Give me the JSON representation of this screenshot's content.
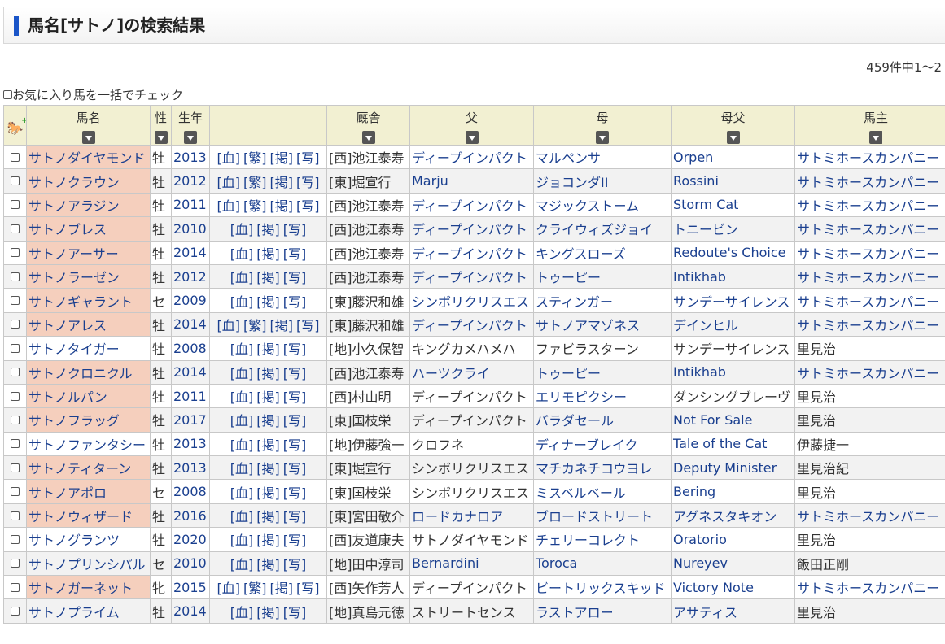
{
  "page": {
    "title": "馬名[サトノ]の検索結果",
    "result_count": "459件中1～2",
    "bulk_check_label": "お気に入り馬を一括でチェック"
  },
  "headers": {
    "name": "馬名",
    "sex": "性",
    "year": "生年",
    "links": "",
    "trainer": "厩舎",
    "sire": "父",
    "dam": "母",
    "damsire": "母父",
    "owner": "馬主"
  },
  "link_labels": {
    "blood": "[血]",
    "hanshoku": "[繁]",
    "keisai": "[掲]",
    "photo": "[写]"
  },
  "rows": [
    {
      "name": "サトノダイヤモンド",
      "sex": "牡",
      "year": "2013",
      "hanshoku": true,
      "trainer": "[西]池江泰寿",
      "sire": "ディープインパクト",
      "sire_link": true,
      "dam": "マルペンサ",
      "dam_link": true,
      "damsire": "Orpen",
      "damsire_link": true,
      "owner": "サトミホースカンパニー",
      "owner_link": true,
      "highlight": true
    },
    {
      "name": "サトノクラウン",
      "sex": "牡",
      "year": "2012",
      "hanshoku": true,
      "trainer": "[東]堀宣行",
      "sire": "Marju",
      "sire_link": true,
      "dam": "ジョコンダII",
      "dam_link": true,
      "damsire": "Rossini",
      "damsire_link": true,
      "owner": "サトミホースカンパニー",
      "owner_link": true,
      "highlight": true
    },
    {
      "name": "サトノアラジン",
      "sex": "牡",
      "year": "2011",
      "hanshoku": true,
      "trainer": "[西]池江泰寿",
      "sire": "ディープインパクト",
      "sire_link": true,
      "dam": "マジックストーム",
      "dam_link": true,
      "damsire": "Storm Cat",
      "damsire_link": true,
      "owner": "サトミホースカンパニー",
      "owner_link": true,
      "highlight": true
    },
    {
      "name": "サトノブレス",
      "sex": "牡",
      "year": "2010",
      "hanshoku": false,
      "trainer": "[西]池江泰寿",
      "sire": "ディープインパクト",
      "sire_link": true,
      "dam": "クライウィズジョイ",
      "dam_link": true,
      "damsire": "トニービン",
      "damsire_link": true,
      "owner": "サトミホースカンパニー",
      "owner_link": true,
      "highlight": true
    },
    {
      "name": "サトノアーサー",
      "sex": "牡",
      "year": "2014",
      "hanshoku": false,
      "trainer": "[西]池江泰寿",
      "sire": "ディープインパクト",
      "sire_link": true,
      "dam": "キングスローズ",
      "dam_link": true,
      "damsire": "Redoute's Choice",
      "damsire_link": true,
      "owner": "サトミホースカンパニー",
      "owner_link": true,
      "highlight": true
    },
    {
      "name": "サトノラーゼン",
      "sex": "牡",
      "year": "2012",
      "hanshoku": false,
      "trainer": "[西]池江泰寿",
      "sire": "ディープインパクト",
      "sire_link": true,
      "dam": "トゥーピー",
      "dam_link": true,
      "damsire": "Intikhab",
      "damsire_link": true,
      "owner": "サトミホースカンパニー",
      "owner_link": true,
      "highlight": true
    },
    {
      "name": "サトノギャラント",
      "sex": "セ",
      "year": "2009",
      "hanshoku": false,
      "trainer": "[東]藤沢和雄",
      "sire": "シンボリクリスエス",
      "sire_link": true,
      "dam": "スティンガー",
      "dam_link": true,
      "damsire": "サンデーサイレンス",
      "damsire_link": true,
      "owner": "サトミホースカンパニー",
      "owner_link": true,
      "highlight": true
    },
    {
      "name": "サトノアレス",
      "sex": "牡",
      "year": "2014",
      "hanshoku": true,
      "trainer": "[東]藤沢和雄",
      "sire": "ディープインパクト",
      "sire_link": true,
      "dam": "サトノアマゾネス",
      "dam_link": true,
      "damsire": "デインヒル",
      "damsire_link": true,
      "owner": "サトミホースカンパニー",
      "owner_link": true,
      "highlight": true
    },
    {
      "name": "サトノタイガー",
      "sex": "牡",
      "year": "2008",
      "hanshoku": false,
      "trainer": "[地]小久保智",
      "sire": "キングカメハメハ",
      "sire_link": false,
      "dam": "ファビラスターン",
      "dam_link": false,
      "damsire": "サンデーサイレンス",
      "damsire_link": false,
      "owner": "里見治",
      "owner_link": false,
      "highlight": false
    },
    {
      "name": "サトノクロニクル",
      "sex": "牡",
      "year": "2014",
      "hanshoku": false,
      "trainer": "[西]池江泰寿",
      "sire": "ハーツクライ",
      "sire_link": true,
      "dam": "トゥーピー",
      "dam_link": true,
      "damsire": "Intikhab",
      "damsire_link": true,
      "owner": "サトミホースカンパニー",
      "owner_link": true,
      "highlight": true
    },
    {
      "name": "サトノルパン",
      "sex": "牡",
      "year": "2011",
      "hanshoku": false,
      "trainer": "[西]村山明",
      "sire": "ディープインパクト",
      "sire_link": false,
      "dam": "エリモピクシー",
      "dam_link": true,
      "damsire": "ダンシングブレーヴ",
      "damsire_link": false,
      "owner": "里見治",
      "owner_link": false,
      "highlight": true
    },
    {
      "name": "サトノフラッグ",
      "sex": "牡",
      "year": "2017",
      "hanshoku": false,
      "trainer": "[東]国枝栄",
      "sire": "ディープインパクト",
      "sire_link": false,
      "dam": "バラダセール",
      "dam_link": true,
      "damsire": "Not For Sale",
      "damsire_link": true,
      "owner": "里見治",
      "owner_link": false,
      "highlight": true
    },
    {
      "name": "サトノファンタシー",
      "sex": "牡",
      "year": "2013",
      "hanshoku": false,
      "trainer": "[地]伊藤強一",
      "sire": "クロフネ",
      "sire_link": false,
      "dam": "ディナーブレイク",
      "dam_link": true,
      "damsire": "Tale of the Cat",
      "damsire_link": true,
      "owner": "伊藤捷一",
      "owner_link": false,
      "highlight": false
    },
    {
      "name": "サトノティターン",
      "sex": "牡",
      "year": "2013",
      "hanshoku": false,
      "trainer": "[東]堀宣行",
      "sire": "シンボリクリスエス",
      "sire_link": false,
      "dam": "マチカネチコウヨレ",
      "dam_link": true,
      "damsire": "Deputy Minister",
      "damsire_link": true,
      "owner": "里見治紀",
      "owner_link": false,
      "highlight": true
    },
    {
      "name": "サトノアポロ",
      "sex": "セ",
      "year": "2008",
      "hanshoku": false,
      "trainer": "[東]国枝栄",
      "sire": "シンボリクリスエス",
      "sire_link": false,
      "dam": "ミスベルベール",
      "dam_link": true,
      "damsire": "Bering",
      "damsire_link": true,
      "owner": "里見治",
      "owner_link": false,
      "highlight": true
    },
    {
      "name": "サトノウィザード",
      "sex": "牡",
      "year": "2016",
      "hanshoku": false,
      "trainer": "[東]宮田敬介",
      "sire": "ロードカナロア",
      "sire_link": true,
      "dam": "ブロードストリート",
      "dam_link": true,
      "damsire": "アグネスタキオン",
      "damsire_link": true,
      "owner": "サトミホースカンパニー",
      "owner_link": true,
      "highlight": true
    },
    {
      "name": "サトノグランツ",
      "sex": "牡",
      "year": "2020",
      "hanshoku": false,
      "trainer": "[西]友道康夫",
      "sire": "サトノダイヤモンド",
      "sire_link": false,
      "dam": "チェリーコレクト",
      "dam_link": true,
      "damsire": "Oratorio",
      "damsire_link": true,
      "owner": "里見治",
      "owner_link": false,
      "highlight": false
    },
    {
      "name": "サトノプリンシパル",
      "sex": "セ",
      "year": "2010",
      "hanshoku": false,
      "trainer": "[地]田中淳司",
      "sire": "Bernardini",
      "sire_link": true,
      "dam": "Toroca",
      "dam_link": true,
      "damsire": "Nureyev",
      "damsire_link": true,
      "owner": "飯田正剛",
      "owner_link": false,
      "highlight": false
    },
    {
      "name": "サトノガーネット",
      "sex": "牝",
      "year": "2015",
      "hanshoku": true,
      "trainer": "[西]矢作芳人",
      "sire": "ディープインパクト",
      "sire_link": false,
      "dam": "ビートリックスキッド",
      "dam_link": true,
      "damsire": "Victory Note",
      "damsire_link": true,
      "owner": "サトミホースカンパニー",
      "owner_link": true,
      "highlight": true
    },
    {
      "name": "サトノプライム",
      "sex": "牡",
      "year": "2014",
      "hanshoku": false,
      "trainer": "[地]真島元徳",
      "sire": "ストリートセンス",
      "sire_link": false,
      "dam": "ラストアロー",
      "dam_link": true,
      "damsire": "アサティス",
      "damsire_link": true,
      "owner": "里見治",
      "owner_link": false,
      "highlight": false
    }
  ]
}
